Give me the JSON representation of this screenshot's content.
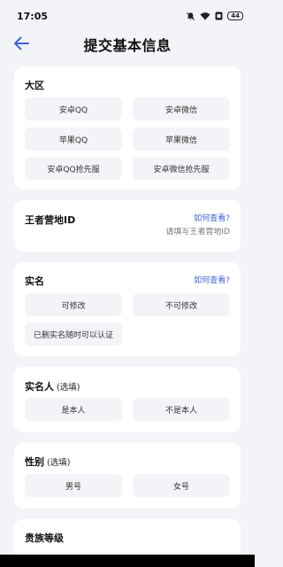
{
  "status_bar": {
    "time": "17:05",
    "battery": "44"
  },
  "header": {
    "title": "提交基本信息"
  },
  "region": {
    "title": "大区",
    "options": [
      "安卓QQ",
      "安卓微信",
      "苹果QQ",
      "苹果微信",
      "安卓QQ抢先服",
      "安卓微信抢先服"
    ]
  },
  "camp_id": {
    "title": "王者营地ID",
    "help_link": "如何查看?",
    "placeholder": "请填写王者营地ID"
  },
  "real_name": {
    "title": "实名",
    "help_link": "如何查看?",
    "options": [
      "可修改",
      "不可修改",
      "已删实名随时可以认证"
    ]
  },
  "real_name_person": {
    "title": "实名人",
    "optional": "(选填)",
    "options": [
      "是本人",
      "不是本人"
    ]
  },
  "gender": {
    "title": "性别",
    "optional": "(选填)",
    "options": [
      "男号",
      "女号"
    ]
  },
  "noble_level": {
    "title": "贵族等级"
  },
  "colors": {
    "accent": "#3e63dd",
    "background": "#f3f4f8",
    "pill": "#f3f4f7"
  }
}
